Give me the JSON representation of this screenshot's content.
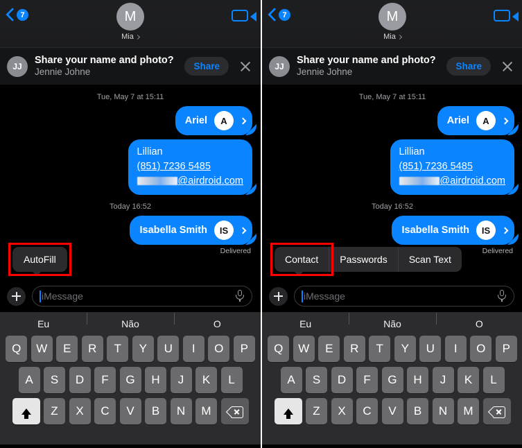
{
  "nav": {
    "back_badge": "7",
    "back_icon": "chevron-left-icon",
    "avatar_initial": "M",
    "contact_name": "Mia",
    "facetime_icon": "video-camera-icon"
  },
  "banner": {
    "avatar_initials": "JJ",
    "title": "Share your name and photo?",
    "subtitle": "Jennie Johne",
    "share_label": "Share",
    "close_icon": "close-icon"
  },
  "conversation": {
    "timestamp_1": "Tue, May 7 at 15:11",
    "timestamp_2": "Today 16:52",
    "msg_ariel": {
      "name": "Ariel",
      "initial": "A"
    },
    "msg_lillian": {
      "name": "Lillian",
      "phone": "(851) 7236 5485",
      "email_suffix": "@airdroid.com"
    },
    "msg_isabella": {
      "name": "Isabella Smith",
      "initials": "IS"
    },
    "delivered": "Delivered"
  },
  "left_panel": {
    "popup_label": "AutoFill"
  },
  "right_panel": {
    "menu_items": [
      "Contact",
      "Passwords",
      "Scan Text"
    ]
  },
  "input": {
    "plus_icon": "plus-icon",
    "placeholder": "iMessage",
    "mic_icon": "microphone-icon"
  },
  "keyboard": {
    "suggestions": [
      "Eu",
      "Não",
      "O"
    ],
    "row1": [
      "Q",
      "W",
      "E",
      "R",
      "T",
      "Y",
      "U",
      "I",
      "O",
      "P"
    ],
    "row2": [
      "A",
      "S",
      "D",
      "F",
      "G",
      "H",
      "J",
      "K",
      "L"
    ],
    "row3": [
      "Z",
      "X",
      "C",
      "V",
      "B",
      "N",
      "M"
    ],
    "shift_icon": "shift-arrow-icon",
    "delete_icon": "backspace-icon"
  },
  "colors": {
    "accent_blue": "#0a84ff",
    "highlight_red": "#ff0000",
    "bubble_blue": "#0a84ff",
    "key_gray": "#6b6b6d",
    "keyboard_bg": "#2c2c2e"
  }
}
